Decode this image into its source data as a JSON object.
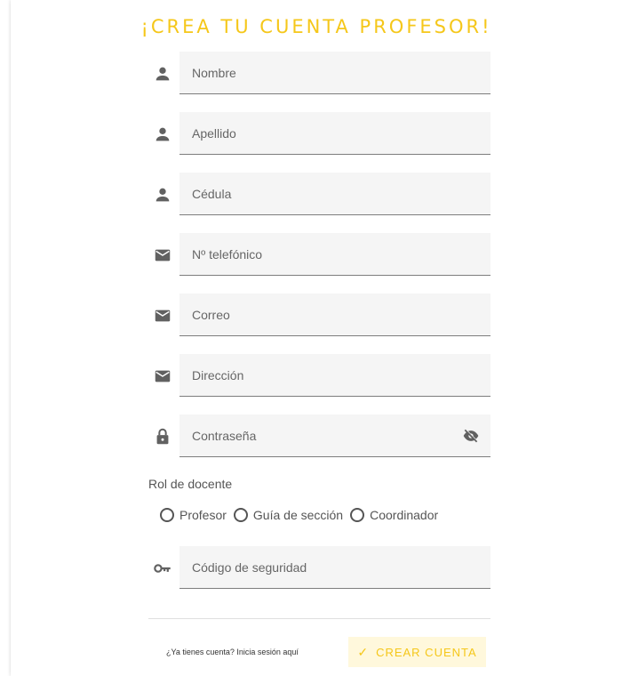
{
  "title": "¡Crea tu cuenta profesor!",
  "colors": {
    "accent": "#f5c71a",
    "field_bg": "#f5f5f5",
    "icon": "#616161"
  },
  "fields": [
    {
      "icon": "person-icon",
      "placeholder": "Nombre"
    },
    {
      "icon": "person-icon",
      "placeholder": "Apellido"
    },
    {
      "icon": "person-icon",
      "placeholder": "Cédula"
    },
    {
      "icon": "email-icon",
      "placeholder": "Nº telefónico"
    },
    {
      "icon": "email-icon",
      "placeholder": "Correo"
    },
    {
      "icon": "email-icon",
      "placeholder": "Dirección"
    },
    {
      "icon": "lock-icon",
      "placeholder": "Contraseña"
    }
  ],
  "role": {
    "label": "Rol de docente",
    "options": [
      "Profesor",
      "Guía de sección",
      "Coordinador"
    ]
  },
  "security": {
    "icon": "key-icon",
    "placeholder": "Código de seguridad"
  },
  "footer": {
    "login_link": "¿Ya tienes cuenta? Inicia sesión aquí",
    "create_button": "Crear cuenta"
  }
}
